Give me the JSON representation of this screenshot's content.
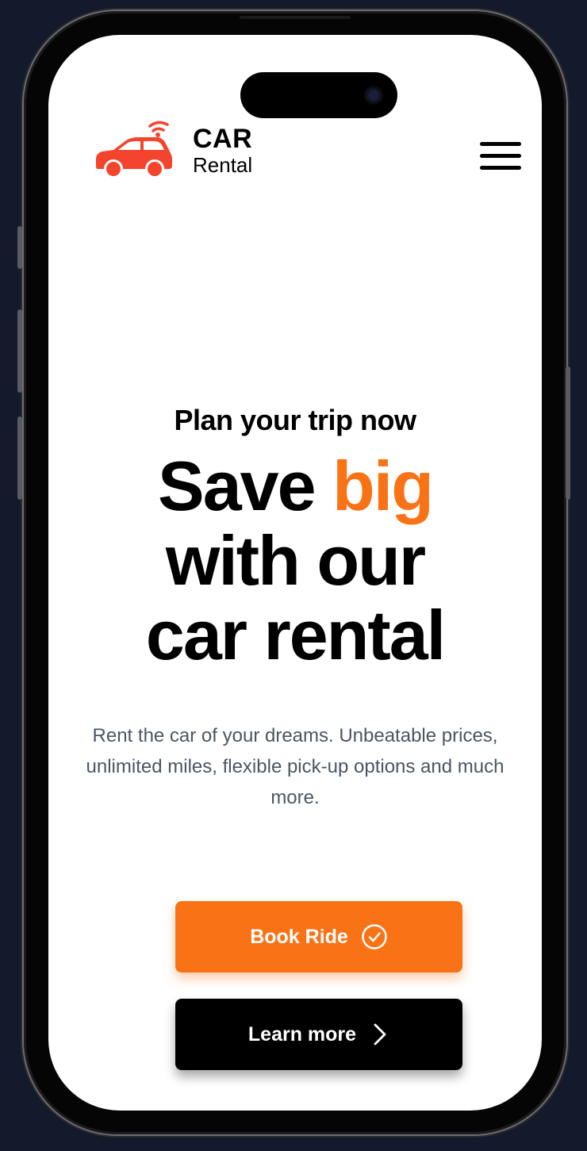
{
  "brand": {
    "title": "CAR",
    "subtitle": "Rental",
    "logo_icon": "car-wifi-icon",
    "logo_color": "#f4442e"
  },
  "header": {
    "menu_icon": "hamburger-menu-icon"
  },
  "hero": {
    "eyebrow": "Plan your trip now",
    "headline_part1": "Save ",
    "headline_accent": "big",
    "headline_line2": "with our",
    "headline_line3": "car rental",
    "description_line1": "Rent the car of your dreams. Unbeatable prices,",
    "description_line2": "unlimited miles, flexible pick-up options and much more.",
    "accent_color": "#f97316"
  },
  "buttons": {
    "book_label": "Book Ride",
    "book_icon": "check-circle-icon",
    "learn_label": "Learn more",
    "learn_icon": "chevron-right-icon"
  }
}
